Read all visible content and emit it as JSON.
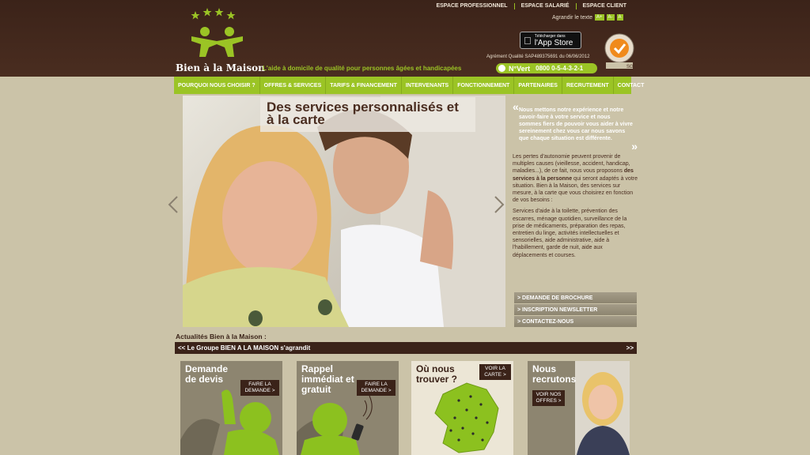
{
  "top_links": [
    "ESPACE PROFESSIONNEL",
    "ESPACE SALARIÉ",
    "ESPACE CLIENT"
  ],
  "text_size": {
    "label": "Agrandir le texte",
    "buttons": [
      "A+",
      "A-",
      "A"
    ]
  },
  "brand": {
    "name": "Bien à la Maison",
    "tagline": "L'aide à domicile de qualité pour personnes âgées et handicapées"
  },
  "appstore": {
    "sub": "Télécharger dans",
    "main": "l'App Store"
  },
  "agrement": "Agrément Qualité SAP489375691 du 06/06/2012",
  "green_number": {
    "label": "N°Vert",
    "number": "0800 0-5-4-3-2-1"
  },
  "nav": [
    "POURQUOI NOUS CHOISIR ?",
    "OFFRES & SERVICES",
    "TARIFS & FINANCEMENT",
    "INTERVENANTS",
    "FONCTIONNEMENT",
    "PARTENAIRES",
    "RECRUTEMENT",
    "CONTACT"
  ],
  "slide": {
    "title": "Des services personnalisés et à la carte"
  },
  "quote": "Nous mettons notre expérience et notre savoir-faire à votre service et nous sommes fiers de pouvoir vous aider à vivre sereinement chez vous car nous savons que chaque situation est différente.",
  "para1_a": "Les pertes d'autonomie peuvent provenir de multiples causes (vieillesse, accident, handicap, maladies...), de ce fait, nous vous proposons ",
  "para1_b": "des services à la personne",
  "para1_c": " qui seront adaptés à votre situation. Bien à la Maison, des services sur mesure, à la carte que vous choisirez en fonction de vos besoins :",
  "para2": "Services d'aide à la toilette, prévention des escarres, ménage quotidien, surveillance de la prise de médicaments, préparation des repas, entretien du linge, activités intellectuelles et sensorielles, aide administrative, aide à l'habillement, garde de nuit, aide aux déplacements et courses.",
  "ctas": [
    "> DEMANDE DE BROCHURE",
    "> INSCRIPTION NEWSLETTER",
    "> CONTACTEZ-NOUS"
  ],
  "news": {
    "title": "Actualités Bien à la Maison :",
    "headline": "<< Le Groupe BIEN A LA MAISON s'agrandit",
    "next": ">>"
  },
  "tiles": [
    {
      "title": "Demande de devis",
      "button": "FAIRE LA DEMANDE >"
    },
    {
      "title": "Rappel immédiat et gratuit",
      "button": "FAIRE LA DEMANDE >"
    },
    {
      "title": "Où nous trouver ?",
      "button": "VOIR LA CARTE >"
    },
    {
      "title": "Nous recrutons",
      "button": "VOIR NOS OFFRES >"
    }
  ],
  "colors": {
    "brown": "#3b2319",
    "green": "#9bc425",
    "beige": "#cbc3a8"
  }
}
